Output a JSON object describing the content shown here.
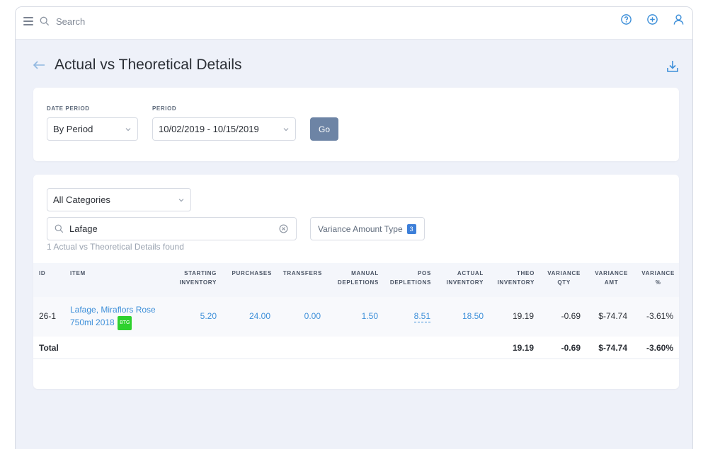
{
  "topbar": {
    "search_placeholder": "Search",
    "icons": [
      "menu-icon",
      "search-icon",
      "help-icon",
      "add-icon",
      "user-icon"
    ]
  },
  "page": {
    "title": "Actual vs Theoretical Details"
  },
  "filters": {
    "date_period_label": "DATE PERIOD",
    "date_period_value": "By Period",
    "period_label": "PERIOD",
    "period_value": "10/02/2019 - 10/15/2019",
    "go_label": "Go"
  },
  "list": {
    "category_value": "All Categories",
    "search_value": "Lafage",
    "variance_type_label": "Variance Amount Type",
    "variance_type_count": "3",
    "found_text": "1 Actual vs Theoretical Details found"
  },
  "table": {
    "headers": {
      "id": "ID",
      "item": "ITEM",
      "starting_inventory": [
        "STARTING",
        "INVENTORY"
      ],
      "purchases": "PURCHASES",
      "transfers": "TRANSFERS",
      "manual_depletions": [
        "MANUAL",
        "DEPLETIONS"
      ],
      "pos_depletions": [
        "POS",
        "DEPLETIONS"
      ],
      "actual_inventory": [
        "ACTUAL",
        "INVENTORY"
      ],
      "theo_inventory": [
        "THEO",
        "INVENTORY"
      ],
      "variance_qty": [
        "VARIANCE",
        "QTY"
      ],
      "variance_amt": [
        "VARIANCE",
        "AMT"
      ],
      "variance_pct": [
        "VARIANCE",
        "%"
      ]
    },
    "rows": [
      {
        "id": "26-1",
        "item_line1": "Lafage, Miraflors Rose",
        "item_line2": "750ml 2018",
        "badge": "BTG",
        "starting_inventory": "5.20",
        "purchases": "24.00",
        "transfers": "0.00",
        "manual_depletions": "1.50",
        "pos_depletions": "8.51",
        "actual_inventory": "18.50",
        "theo_inventory": "19.19",
        "variance_qty": "-0.69",
        "variance_amt": "$-74.74",
        "variance_pct": "-3.61%"
      }
    ],
    "total": {
      "label": "Total",
      "theo_inventory": "19.19",
      "variance_qty": "-0.69",
      "variance_amt": "$-74.74",
      "variance_pct": "-3.60%"
    }
  },
  "colors": {
    "accent": "#3d8fd9",
    "go_button": "#6d84a5",
    "badge_green": "#2ed12e",
    "background": "#eef1f9"
  }
}
